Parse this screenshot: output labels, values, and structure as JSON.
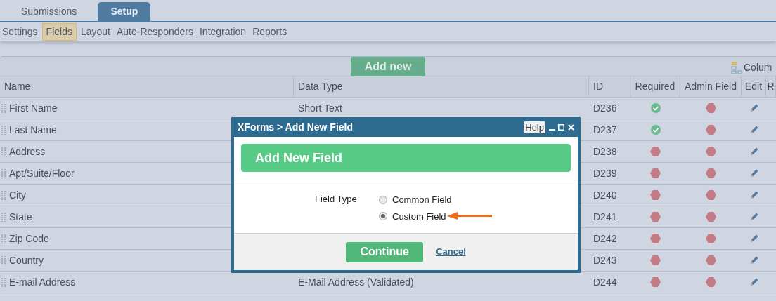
{
  "tabs": [
    {
      "label": "Submissions",
      "selected": false
    },
    {
      "label": "Setup",
      "selected": true
    }
  ],
  "subnav": [
    {
      "label": "Settings",
      "selected": false
    },
    {
      "label": "Fields",
      "selected": true
    },
    {
      "label": "Layout",
      "selected": false
    },
    {
      "label": "Auto-Responders",
      "selected": false
    },
    {
      "label": "Integration",
      "selected": false
    },
    {
      "label": "Reports",
      "selected": false
    }
  ],
  "toolbar": {
    "add_button": "Add new",
    "columns_button": "Colum"
  },
  "table": {
    "columns": [
      "Name",
      "Data Type",
      "ID",
      "Required",
      "Admin Field",
      "Edit",
      "R"
    ],
    "rows": [
      {
        "name": "First Name",
        "data_type": "Short Text",
        "id": "D236",
        "required": true,
        "admin_field": false
      },
      {
        "name": "Last Name",
        "id": "D237",
        "required": true,
        "admin_field": false
      },
      {
        "name": "Address",
        "id": "D238",
        "required": false,
        "admin_field": false
      },
      {
        "name": "Apt/Suite/Floor",
        "id": "D239",
        "required": false,
        "admin_field": false
      },
      {
        "name": "City",
        "id": "D240",
        "required": false,
        "admin_field": false
      },
      {
        "name": "State",
        "id": "D241",
        "required": false,
        "admin_field": false
      },
      {
        "name": "Zip Code",
        "id": "D242",
        "required": false,
        "admin_field": false
      },
      {
        "name": "Country",
        "id": "D243",
        "required": false,
        "admin_field": false
      },
      {
        "name": "E-mail Address",
        "data_type": "E-Mail Address (Validated)",
        "id": "D244",
        "required": false,
        "admin_field": false
      }
    ]
  },
  "dialog": {
    "title": "XForms > Add New Field",
    "help": "Help",
    "heading": "Add New Field",
    "field_label": "Field Type",
    "options": [
      {
        "label": "Common Field",
        "selected": false
      },
      {
        "label": "Custom Field",
        "selected": true
      }
    ],
    "continue": "Continue",
    "cancel": "Cancel"
  }
}
